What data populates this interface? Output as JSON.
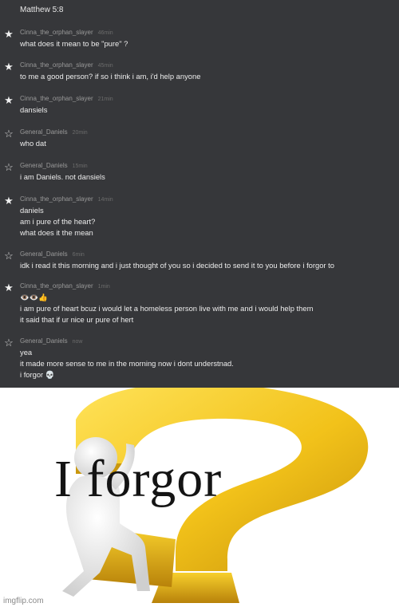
{
  "header": {
    "mark": "˙˙",
    "title": "Matthew 5:8"
  },
  "messages": [
    {
      "star": "★",
      "user": "Cinna_the_orphan_slayer",
      "time": "46min",
      "lines": [
        "what does it mean to be \"pure\" ?"
      ]
    },
    {
      "star": "★",
      "user": "Cinna_the_orphan_slayer",
      "time": "45min",
      "lines": [
        "to me a good person? if so i think i am, i'd help anyone"
      ]
    },
    {
      "star": "★",
      "user": "Cinna_the_orphan_slayer",
      "time": "21min",
      "lines": [
        "dansiels"
      ]
    },
    {
      "star": "☆",
      "user": "General_Daniels",
      "time": "20min",
      "lines": [
        "who dat"
      ]
    },
    {
      "star": "☆",
      "user": "General_Daniels",
      "time": "15min",
      "lines": [
        "i am Daniels. not dansiels"
      ]
    },
    {
      "star": "★",
      "user": "Cinna_the_orphan_slayer",
      "time": "14min",
      "lines": [
        "daniels",
        "am i pure of the heart?",
        "what does it the mean"
      ]
    },
    {
      "star": "☆",
      "user": "General_Daniels",
      "time": "6min",
      "lines": [
        "idk i read it this morning and i just thought of you so i decided to send it to you before i forgor to"
      ]
    },
    {
      "star": "★",
      "user": "Cinna_the_orphan_slayer",
      "time": "1min",
      "lines": [
        "👁️👁️👍",
        "i am pure of heart bcuz i would let a homeless person live with me and i would help them",
        "it said that if ur nice ur pure of hert"
      ]
    },
    {
      "star": "☆",
      "user": "General_Daniels",
      "time": "now",
      "lines": [
        "yea",
        "it made more sense to me in the morning now i dont understnad.",
        "i forgor 💀"
      ]
    }
  ],
  "meme": {
    "caption": "I forgor"
  },
  "watermark": "imgflip.com",
  "colors": {
    "chat_bg": "#36373a",
    "username": "#9a9a9a",
    "text": "#ececec",
    "question_mark": "#f2c21a"
  }
}
